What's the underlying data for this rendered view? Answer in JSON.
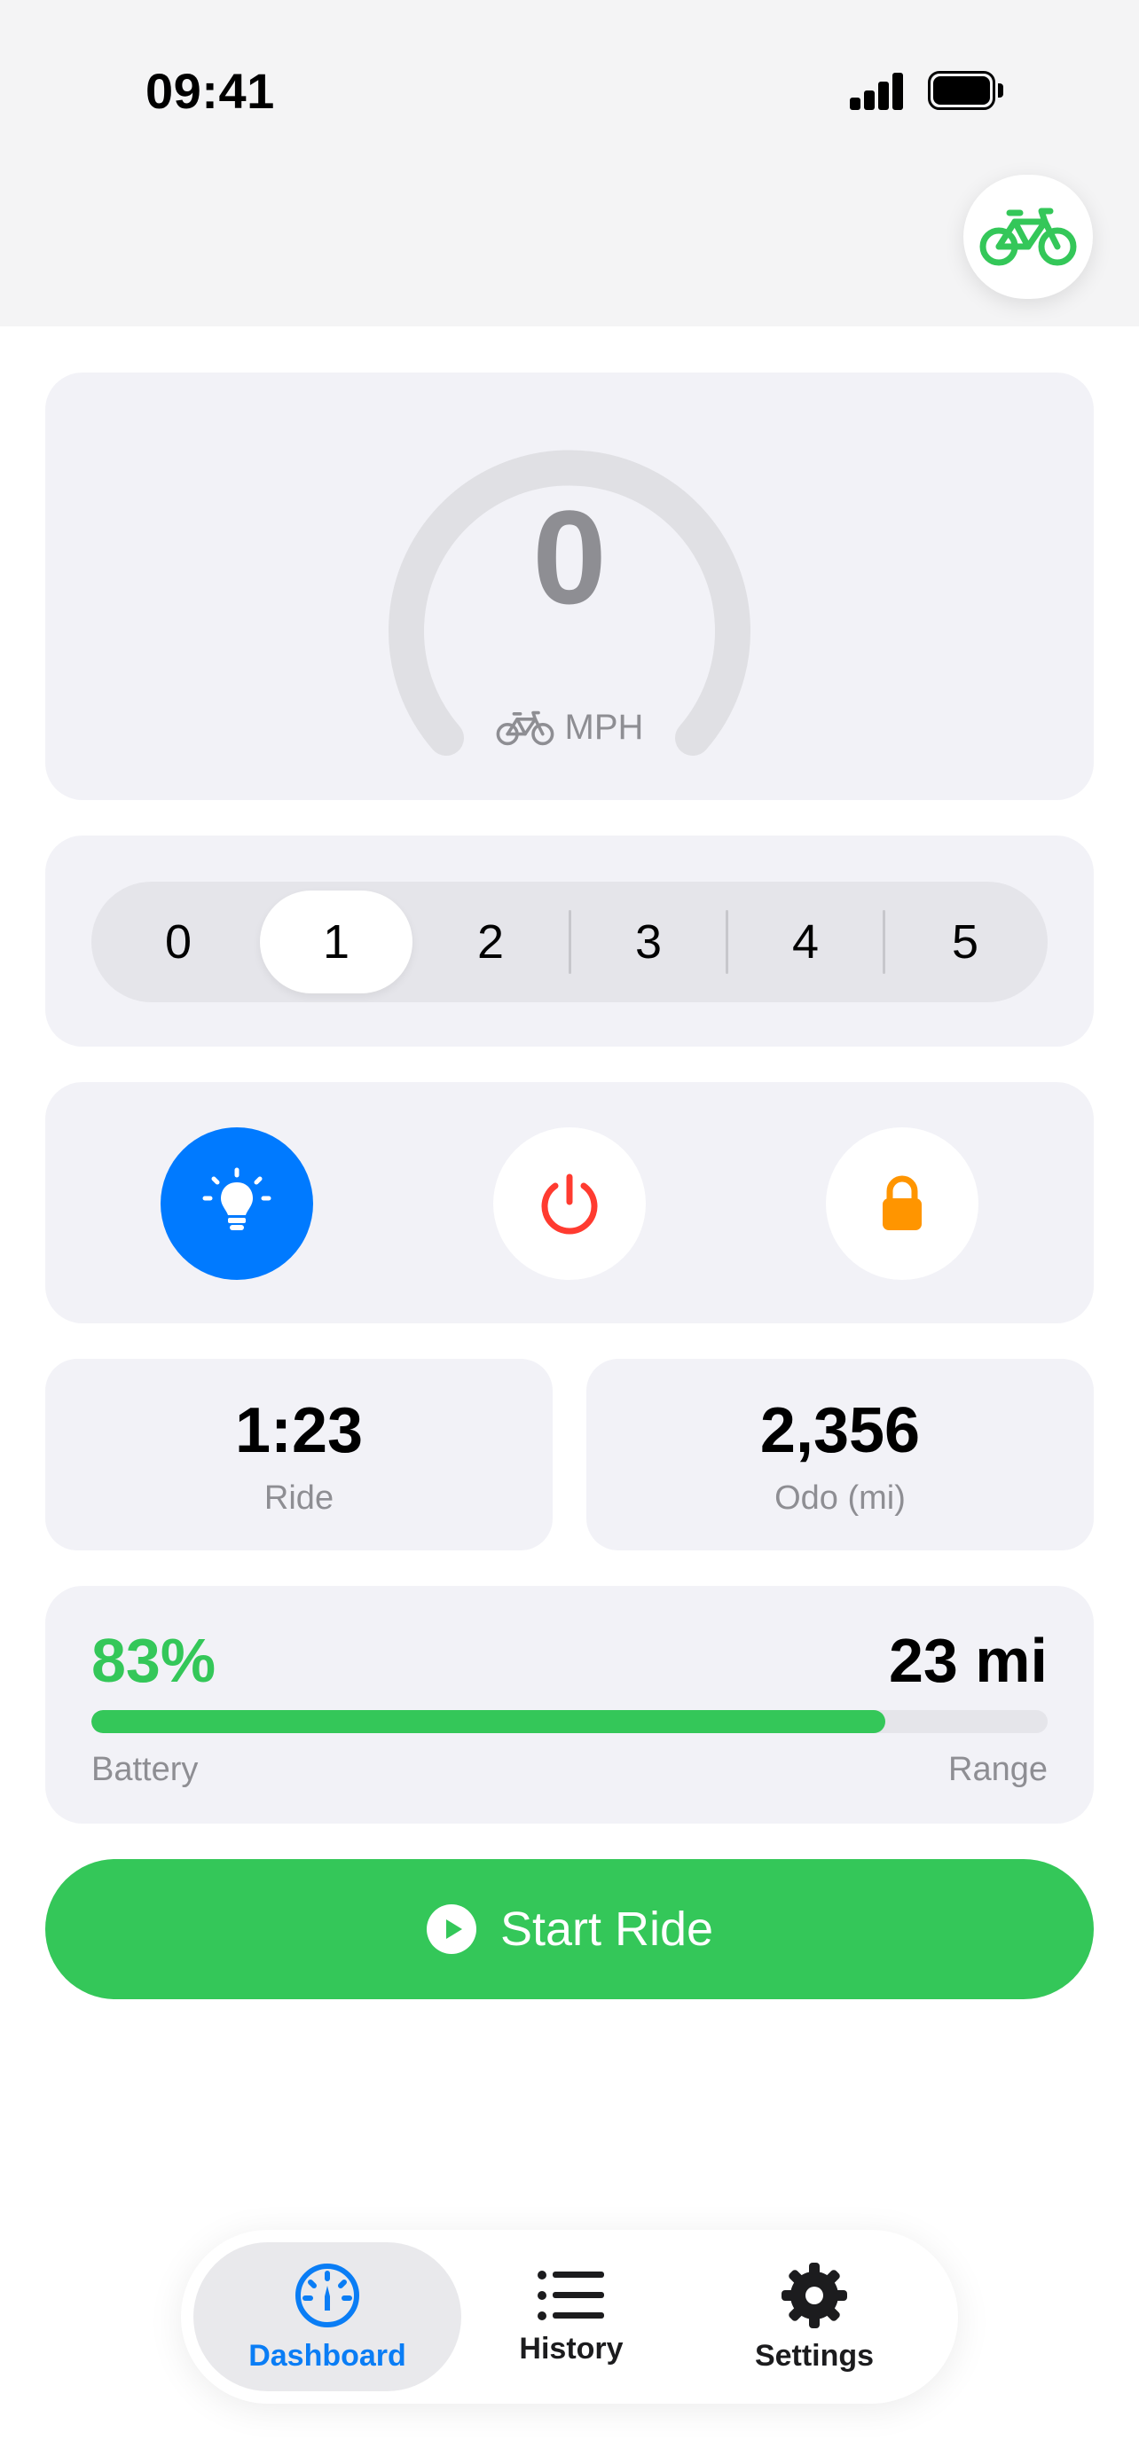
{
  "status_bar": {
    "time": "09:41"
  },
  "speedometer": {
    "speed": "0",
    "unit": "MPH"
  },
  "assist": {
    "levels": [
      "0",
      "1",
      "2",
      "3",
      "4",
      "5"
    ],
    "selected": "1"
  },
  "controls": {
    "light": {
      "state": "on",
      "color": "#007aff",
      "icon": "lightbulb-icon"
    },
    "power": {
      "color": "#ff3b30",
      "icon": "power-icon"
    },
    "lock": {
      "color": "#ff9500",
      "icon": "lock-icon"
    }
  },
  "stats": {
    "ride": {
      "value": "1:23",
      "label": "Ride"
    },
    "odo": {
      "value": "2,356",
      "label": "Odo (mi)"
    }
  },
  "battery": {
    "percent_text": "83%",
    "level": 0.83,
    "range_text": "23 mi",
    "battery_label": "Battery",
    "range_label": "Range",
    "color": "#34c759"
  },
  "start_button": {
    "label": "Start Ride"
  },
  "tabs": [
    {
      "label": "Dashboard",
      "icon": "gauge-icon",
      "active": true
    },
    {
      "label": "History",
      "icon": "list-icon",
      "active": false
    },
    {
      "label": "Settings",
      "icon": "gear-icon",
      "active": false
    }
  ],
  "colors": {
    "accent": "#007aff",
    "green": "#34c759",
    "red": "#ff3b30",
    "orange": "#ff9500"
  }
}
